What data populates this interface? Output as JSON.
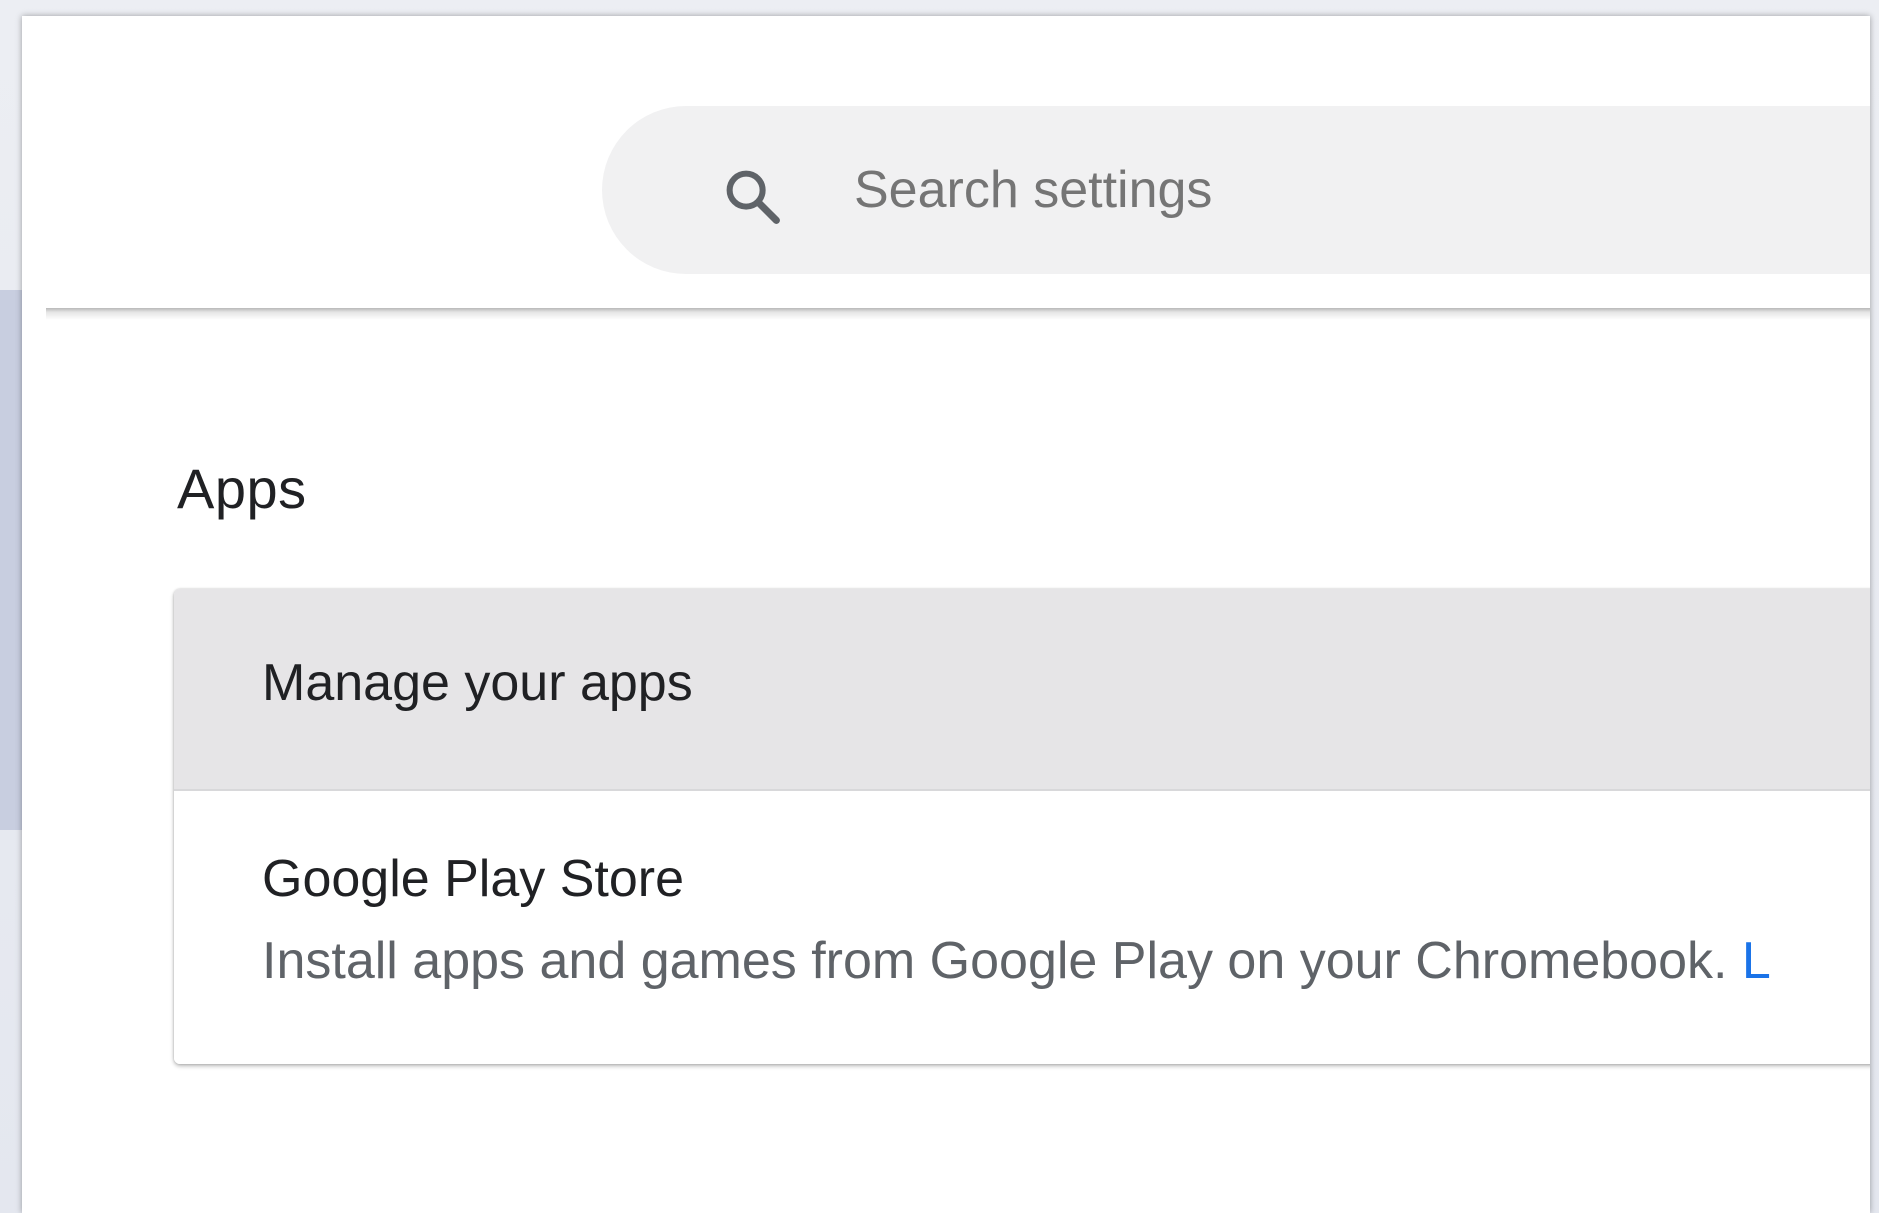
{
  "search": {
    "placeholder": "Search settings",
    "icon": "search-icon"
  },
  "apps_section": {
    "title": "Apps",
    "rows": [
      {
        "label": "Manage your apps"
      },
      {
        "title": "Google Play Store",
        "description": "Install apps and games from Google Play on your Chromebook. ",
        "link_text": "L"
      }
    ]
  },
  "colors": {
    "link": "#1a73e8",
    "search_bg": "#f1f1f2",
    "hover_row_bg": "#e6e5e7",
    "text_primary": "#202124",
    "text_secondary": "#5f6368"
  }
}
